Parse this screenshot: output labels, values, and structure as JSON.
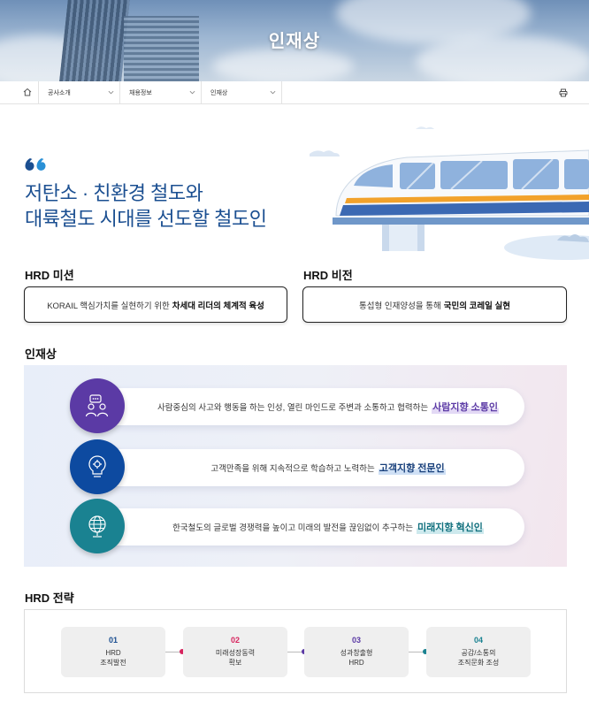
{
  "hero": {
    "title": "인재상"
  },
  "breadcrumb": {
    "items": [
      {
        "label": "공사소개"
      },
      {
        "label": "채용정보"
      },
      {
        "label": "인재상"
      }
    ]
  },
  "intro": {
    "line1": "저탄소 · 친환경 철도와",
    "line2": "대륙철도 시대를 선도할 철도인"
  },
  "mission": {
    "title": "HRD 미션",
    "text": "KORAIL 핵심가치를 실현하기 위한",
    "emphasis": "차세대 리더의 체계적 육성"
  },
  "vision": {
    "title": "HRD 비전",
    "text": "통섭형 인재양성을 통해",
    "emphasis": "국민의 코레일 실현"
  },
  "talent": {
    "title": "인재상",
    "items": [
      {
        "text": "사람중심의 사고와 행동을 하는 인성, 열린 마인드로 주변과 소통하고 협력하는",
        "highlight": "사람지향 소통인",
        "icon": "people-chat-icon",
        "color": "#5b3aa5",
        "highlight_color": "#5b3aa5"
      },
      {
        "text": "고객만족을 위해 지속적으로 학습하고 노력하는",
        "highlight": "고객지향 전문인",
        "icon": "lightbulb-gear-icon",
        "color": "#0d4aa0",
        "highlight_color": "#163e7a"
      },
      {
        "text": "한국철도의 글로벌 경쟁력을 높이고 미래의 발전을 끊임없이 추구하는",
        "highlight": "미래지향 혁신인",
        "icon": "globe-icon",
        "color": "#1a8291",
        "highlight_color": "#0f6f7d"
      }
    ]
  },
  "strategy": {
    "title": "HRD 전략",
    "items": [
      {
        "num": "01",
        "label": "HRD\n조직발전",
        "color": "#1b4f91"
      },
      {
        "num": "02",
        "label": "미래성장동력\n확보",
        "color": "#d7245e"
      },
      {
        "num": "03",
        "label": "성과창출형\nHRD",
        "color": "#5b3aa5"
      },
      {
        "num": "04",
        "label": "공감/소통의\n조직문화 조성",
        "color": "#1a8291"
      }
    ]
  }
}
